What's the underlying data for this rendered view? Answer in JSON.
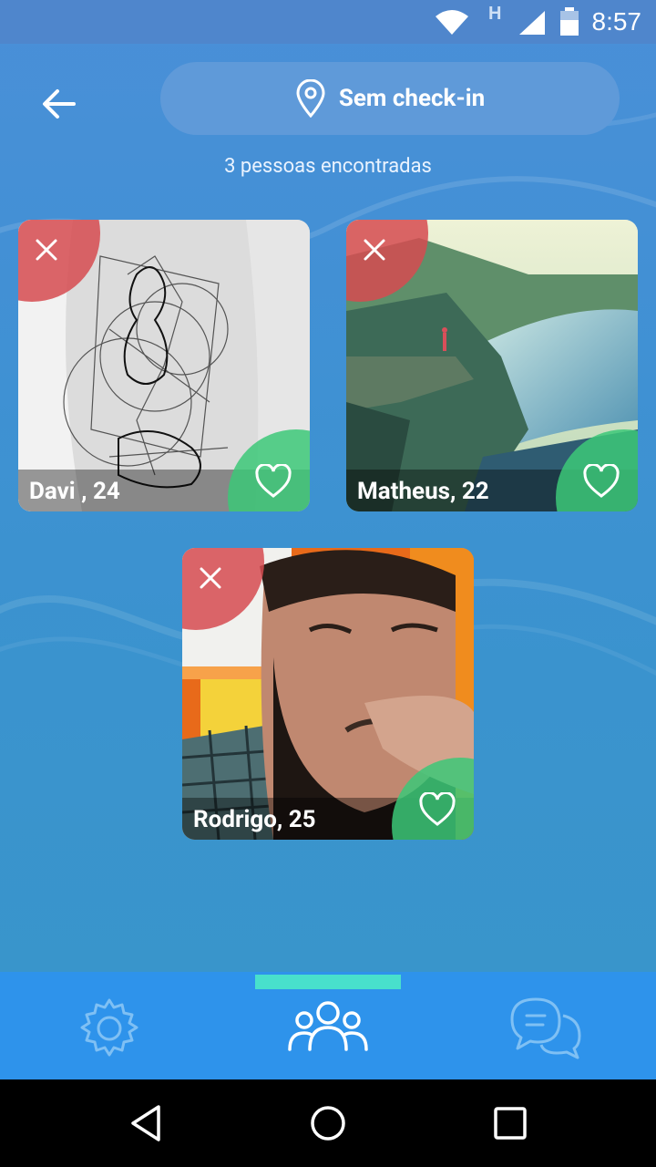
{
  "status_bar": {
    "time": "8:57",
    "network_label": "H"
  },
  "header": {
    "checkin_label": "Sem check-in",
    "results_text": "3 pessoas encontradas"
  },
  "people": [
    {
      "name_label": "Davi , 24"
    },
    {
      "name_label": "Matheus, 22"
    },
    {
      "name_label": "Rodrigo, 25"
    }
  ],
  "colors": {
    "dislike": "#d64b50",
    "like": "#3cc878",
    "nav_bg": "#2e93eb",
    "nav_indicator": "#48e0cc"
  }
}
